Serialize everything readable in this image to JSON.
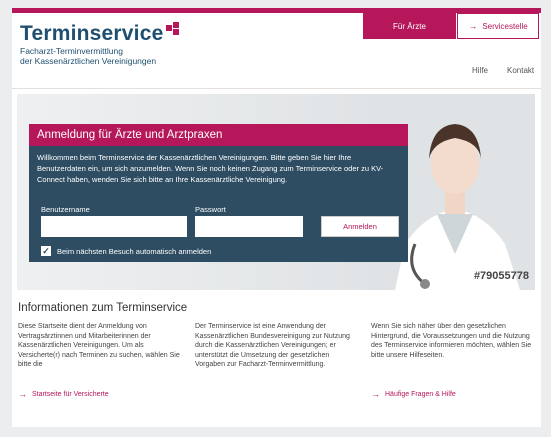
{
  "header": {
    "logo_title": "Terminservice",
    "logo_sub_1": "Facharzt-Terminvermittlung",
    "logo_sub_2": "der Kassenärztlichen Vereinigungen",
    "btn_aerzte": "Für Ärzte",
    "btn_servicestelle": "Servicestelle",
    "nav_hilfe": "Hilfe",
    "nav_kontakt": "Kontakt"
  },
  "login": {
    "title": "Anmeldung für Ärzte und Arztpraxen",
    "intro": "Willkommen beim Terminservice der Kassenärztlichen Vereinigungen. Bitte geben Sie hier Ihre Benutzerdaten ein, um sich anzumelden. Wenn Sie noch keinen Zugang zum Terminservice oder zu KV-Connect haben, wenden Sie sich bitte an Ihre Kassenärztliche Vereinigung.",
    "username_label": "Benutzername",
    "password_label": "Passwort",
    "username_value": "",
    "password_value": "",
    "submit_label": "Anmelden",
    "remember_label": "Beim nächsten Besuch automatisch anmelden",
    "remember_checked": true
  },
  "hero": {
    "photo_id": "#79055778"
  },
  "info": {
    "title": "Informationen zum Terminservice",
    "col1_text": "Diese Startseite dient der Anmeldung von Vertragsärztinnen und Mitarbeiterinnen der Kassenärztlichen Vereinigungen. Um als Versicherte(r) nach Terminen zu suchen, wählen Sie bitte die",
    "col1_link": "Startseite für Versicherte",
    "col2_text": "Der Terminservice ist eine Anwendung der Kassenärztlichen Bundesvereinigung zur Nutzung durch die Kassenärztlichen Vereinigungen; er unterstützt die Umsetzung der gesetzlichen Vorgaben zur Facharzt-Terminvermittlung.",
    "col3_text": "Wenn Sie sich näher über den gesetzlichen Hintergrund, die Voraussetzungen und die Nutzung des Terminservice informieren möchten, wählen Sie bitte unsere Hilfeseiten.",
    "col3_link": "Häufige Fragen & Hilfe"
  },
  "colors": {
    "brand_magenta": "#b5175a",
    "panel_blue": "#2e4d62",
    "logo_blue": "#1f4f70"
  }
}
